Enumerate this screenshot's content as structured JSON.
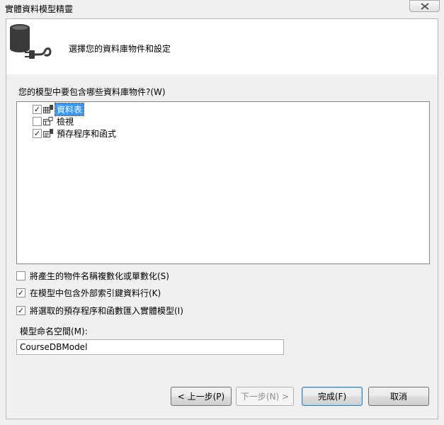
{
  "window": {
    "title": "實體資料模型精靈"
  },
  "header": {
    "title": "選擇您的資料庫物件和設定"
  },
  "objects": {
    "question": "您的模型中要包含哪些資料庫物件?(W)",
    "items": [
      {
        "label": "資料表",
        "checked": true,
        "icon": "table-icon",
        "selected": true
      },
      {
        "label": "檢視",
        "checked": false,
        "icon": "view-icon",
        "selected": false
      },
      {
        "label": "預存程序和函式",
        "checked": true,
        "icon": "stored-procedure-icon",
        "selected": false
      }
    ]
  },
  "options": [
    {
      "label": "將產生的物件名稱複數化或單數化(S)",
      "checked": false
    },
    {
      "label": "在模型中包含外部索引鍵資料行(K)",
      "checked": true
    },
    {
      "label": "將選取的預存程序和函數匯入實體模型(I)",
      "checked": true
    }
  ],
  "namespace": {
    "label": "模型命名空間(M):",
    "value": "CourseDBModel"
  },
  "buttons": {
    "previous": "< 上一步(P)",
    "next": "下一步(N) >",
    "finish": "完成(F)",
    "cancel": "取消"
  },
  "colors": {
    "selection": "#3399ff",
    "header_bg": "#ffffff",
    "dialog_bg": "#f0f0f0"
  }
}
